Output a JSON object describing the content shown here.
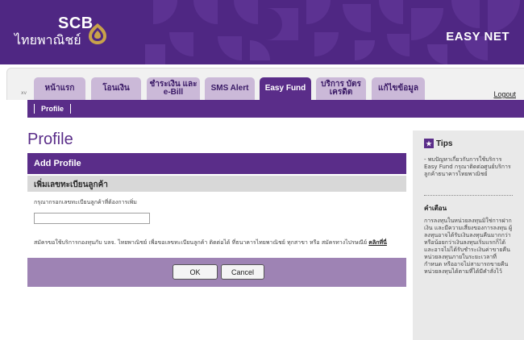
{
  "header": {
    "brand_en": "SCB",
    "brand_th": "ไทยพาณิชย์",
    "product": "EASY NET"
  },
  "nav": {
    "corner_label": "xv",
    "tabs": [
      {
        "label": "หน้าแรก"
      },
      {
        "label": "โอนเงิน"
      },
      {
        "label": "ชำระเงิน และ e-Bill"
      },
      {
        "label": "SMS Alert"
      },
      {
        "label": "Easy Fund"
      },
      {
        "label": "บริการ บัตรเครดิต"
      },
      {
        "label": "แก้ไขข้อมูล"
      }
    ],
    "active_tab": "Easy Fund",
    "logout": "Logout"
  },
  "subnav": {
    "item": "Profile"
  },
  "main": {
    "page_title": "Profile",
    "section_title": "Add Profile",
    "subsection_title": "เพิ่มเลขทะเบียนลูกค้า",
    "prompt": "กรุณากรอกเลขทะเบียนลูกค้าที่ต้องการเพิ่ม",
    "input_value": "",
    "note": "สมัครขอใช้บริการกองทุนกับ บลจ. ไทยพาณิชย์ เพื่อขอเลขทะเบียนลูกค้า ติดต่อได้ ที่ธนาคารไทยพาณิชย์ ทุกสาขา หรือ สมัครทางไปรษณีย์",
    "note_link": "คลิกที่นี่",
    "ok_label": "OK",
    "cancel_label": "Cancel"
  },
  "sidebar": {
    "tips_title": "Tips",
    "tips_text": "- พบปัญหาเกี่ยวกับการใช้บริการ Easy Fund กรุณาติดต่อศูนย์บริการลูกค้าธนาคารไทยพาณิชย์",
    "warning_title": "คำเตือน",
    "warning_text": "การลงทุนในหน่วยลงทุนมิใช่การฝากเงิน และมีความเสี่ยงของการลงทุน ผู้ลงทุนอาจได้รับเงินลงทุนคืนมากกว่าหรือน้อยกว่าเงินลงทุนเริ่มแรกก็ได้ และอาจไม่ได้รับชำระเงินค่าขายคืนหน่วยลงทุนภายในระยะเวลาที่กำหนด หรืออาจไม่สามารถขายคืนหน่วยลงทุนได้ตามที่ได้มีคำสั่งไว้"
  },
  "colors": {
    "brand_purple": "#5a2d89",
    "banner_purple": "#4f2783",
    "tab_inactive": "#cbb9d8",
    "button_bar": "#9e83b4"
  }
}
